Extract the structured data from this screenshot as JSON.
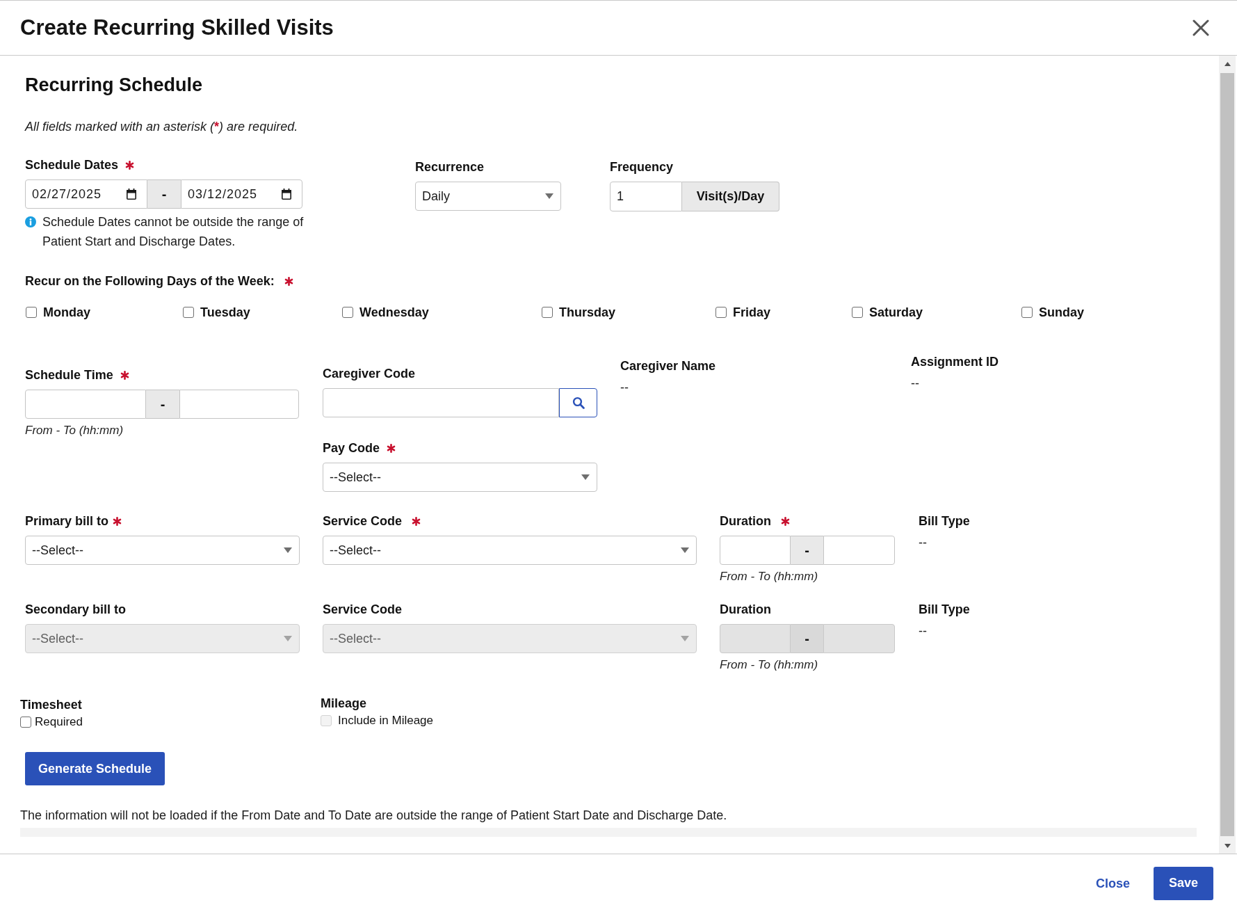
{
  "dialog": {
    "title": "Create Recurring Skilled Visits"
  },
  "schedule": {
    "title": "Recurring Schedule",
    "required_note": {
      "before": "All fields marked with an asterisk (",
      "mark": "*",
      "after": ") are required."
    },
    "schedule_dates": {
      "label": "Schedule Dates",
      "required": true,
      "from": "02/27/2025",
      "separator": "-",
      "to": "03/12/2025",
      "info": "Schedule Dates cannot be outside the range of Patient Start and Discharge Dates."
    },
    "recurrence": {
      "label": "Recurrence",
      "required": false,
      "value": "Daily"
    },
    "frequency": {
      "label": "Frequency",
      "required": false,
      "value": "1",
      "unit": "Visit(s)/Day"
    },
    "days": {
      "label": "Recur on the Following Days of the Week:",
      "required": true,
      "items": [
        {
          "label": "Monday",
          "checked": false
        },
        {
          "label": "Tuesday",
          "checked": false
        },
        {
          "label": "Wednesday",
          "checked": false
        },
        {
          "label": "Thursday",
          "checked": false
        },
        {
          "label": "Friday",
          "checked": false
        },
        {
          "label": "Saturday",
          "checked": false
        },
        {
          "label": "Sunday",
          "checked": false
        }
      ]
    },
    "schedule_time": {
      "label": "Schedule Time",
      "required": true,
      "separator": "-",
      "hint": "From - To (hh:mm)"
    },
    "caregiver_code": {
      "label": "Caregiver Code",
      "required": false
    },
    "pay_code": {
      "label": "Pay Code",
      "required": true,
      "value": "--Select--"
    },
    "caregiver_name": {
      "label": "Caregiver Name",
      "value": "--"
    },
    "assignment_id": {
      "label": "Assignment ID",
      "value": "--"
    },
    "billing": [
      {
        "bill_to": {
          "label": "Primary bill to",
          "required": true,
          "value": "--Select--",
          "disabled": false
        },
        "service_code": {
          "label": "Service Code",
          "required": true,
          "value": "--Select--",
          "disabled": false
        },
        "duration": {
          "label": "Duration",
          "required": true,
          "separator": "-",
          "hint": "From - To (hh:mm)",
          "disabled": false
        },
        "bill_type": {
          "label": "Bill Type",
          "value": "--"
        }
      },
      {
        "bill_to": {
          "label": "Secondary bill to",
          "required": false,
          "value": "--Select--",
          "disabled": true
        },
        "service_code": {
          "label": "Service Code",
          "required": false,
          "value": "--Select--",
          "disabled": true
        },
        "duration": {
          "label": "Duration",
          "required": false,
          "separator": "-",
          "hint": "From - To (hh:mm)",
          "disabled": true
        },
        "bill_type": {
          "label": "Bill Type",
          "value": "--"
        }
      }
    ],
    "timesheet": {
      "label": "Timesheet",
      "option": {
        "label": "Required",
        "checked": false,
        "disabled": false
      }
    },
    "mileage": {
      "label": "Mileage",
      "option": {
        "label": "Include in Mileage",
        "checked": false,
        "disabled": true
      }
    },
    "generate_button": "Generate Schedule",
    "footnote": "The information will not be loaded if the From Date and To Date are outside the range of Patient Start Date and Discharge Date."
  },
  "footer": {
    "buttons": [
      {
        "label": "Close",
        "kind": "link"
      },
      {
        "label": "Save",
        "kind": "primary"
      }
    ]
  }
}
